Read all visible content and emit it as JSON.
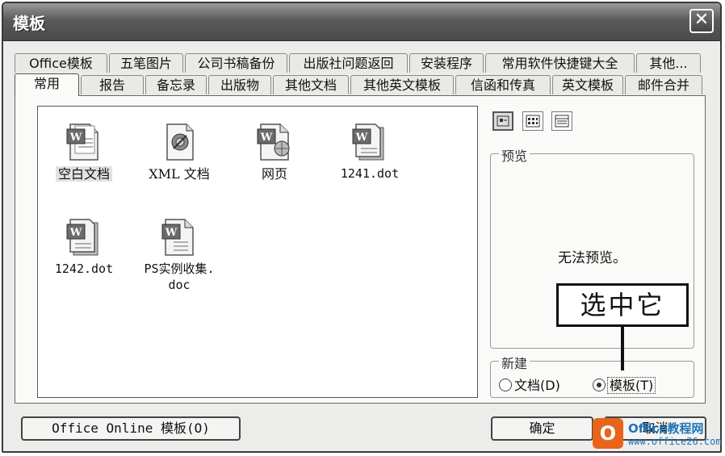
{
  "window": {
    "title": "模板",
    "close_glyph": "✕"
  },
  "tabs_row1": [
    {
      "label": "Office模板"
    },
    {
      "label": "五笔图片"
    },
    {
      "label": "公司书稿备份"
    },
    {
      "label": "出版社问题返回"
    },
    {
      "label": "安装程序"
    },
    {
      "label": "常用软件快捷键大全"
    },
    {
      "label": "其他..."
    }
  ],
  "tabs_row2": [
    {
      "label": "常用",
      "active": true
    },
    {
      "label": "报告"
    },
    {
      "label": "备忘录"
    },
    {
      "label": "出版物"
    },
    {
      "label": "其他文档"
    },
    {
      "label": "其他英文模板"
    },
    {
      "label": "信函和传真"
    },
    {
      "label": "英文模板"
    },
    {
      "label": "邮件合并"
    }
  ],
  "files": [
    {
      "label": "空白文档",
      "icon": "word-document-icon",
      "selected": true
    },
    {
      "label": "XML 文档",
      "icon": "xml-document-icon"
    },
    {
      "label": "网页",
      "icon": "web-page-icon"
    },
    {
      "label": "1241.dot",
      "icon": "word-template-icon"
    },
    {
      "label": "1242.dot",
      "icon": "word-template-icon"
    },
    {
      "label": "PS实例收集.",
      "label2": "doc",
      "icon": "word-document-icon"
    }
  ],
  "view_buttons": [
    "large-icons-view-icon",
    "list-view-icon",
    "details-view-icon"
  ],
  "preview": {
    "group_label": "预览",
    "text": "无法预览。"
  },
  "new_group": {
    "label": "新建",
    "options": [
      {
        "label": "文档(D)",
        "checked": false
      },
      {
        "label": "模板(T)",
        "checked": true
      }
    ]
  },
  "buttons": {
    "office_online": "Office Online 模板(O)",
    "ok": "确定",
    "cancel": "取消"
  },
  "callout": "选中它",
  "watermark": {
    "logo": "O",
    "title": "Office教程网",
    "url": "www.office26.com"
  },
  "colors": {
    "titlebar": "#5a5a5a",
    "dialog_bg": "#ececea",
    "watermark_orange": "#e8641b",
    "watermark_blue": "#1d74b8"
  }
}
